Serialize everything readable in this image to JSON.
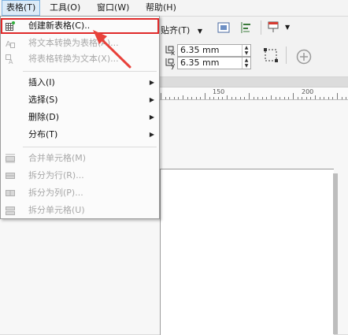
{
  "menubar": {
    "items": [
      {
        "label": "表格(T)"
      },
      {
        "label": "工具(O)"
      },
      {
        "label": "窗口(W)"
      },
      {
        "label": "帮助(H)"
      }
    ]
  },
  "propbar": {
    "snap_label": "贴齐(T)",
    "x_offset": "6.35 mm",
    "y_offset": "6.35 mm",
    "x_sub": "x",
    "y_sub": "y"
  },
  "ruler": {
    "labels": [
      "150",
      "200"
    ]
  },
  "table_menu": {
    "items": [
      {
        "label": "创建新表格(C)..",
        "enabled": true,
        "icon": "create-table-icon"
      },
      {
        "label": "将文本转换为表格(A)...",
        "enabled": false,
        "icon": "text-to-table-icon"
      },
      {
        "label": "将表格转换为文本(X)...",
        "enabled": false,
        "icon": "table-to-text-icon"
      },
      {
        "label": "插入(I)",
        "enabled": true,
        "submenu": true
      },
      {
        "label": "选择(S)",
        "enabled": true,
        "submenu": true
      },
      {
        "label": "删除(D)",
        "enabled": true,
        "submenu": true
      },
      {
        "label": "分布(T)",
        "enabled": true,
        "submenu": true
      },
      {
        "label": "合并单元格(M)",
        "enabled": false,
        "icon": "merge-cells-icon"
      },
      {
        "label": "拆分为行(R)...",
        "enabled": false,
        "icon": "split-rows-icon"
      },
      {
        "label": "拆分为列(P)...",
        "enabled": false,
        "icon": "split-columns-icon"
      },
      {
        "label": "拆分单元格(U)",
        "enabled": false,
        "icon": "split-cells-icon"
      }
    ]
  },
  "colors": {
    "highlight_outline": "#e02a2a",
    "annotation_arrow": "#e8413a",
    "menu_active": "#dcebf8"
  }
}
